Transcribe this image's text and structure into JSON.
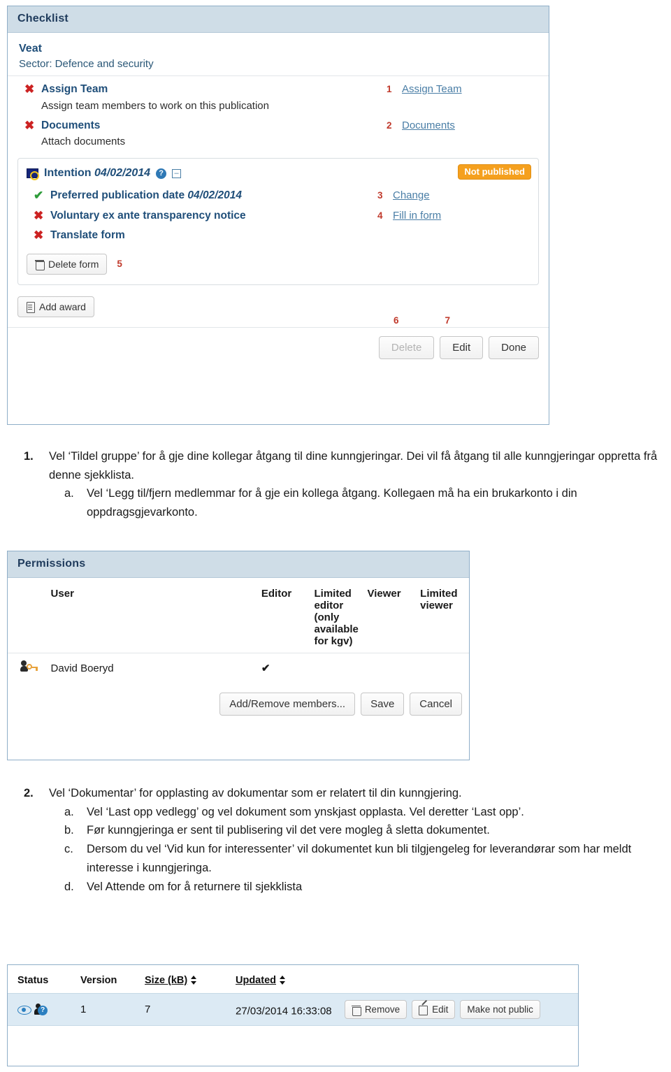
{
  "checklist": {
    "header_title": "Checklist",
    "notice_title": "Veat",
    "sector": "Sector: Defence and security",
    "rows": [
      {
        "status_icon": "cross-icon",
        "label": "Assign Team",
        "description": "Assign team members to work on this publication",
        "step": "1",
        "link": "Assign Team"
      },
      {
        "status_icon": "cross-icon",
        "label": "Documents",
        "description": "Attach documents",
        "step": "2",
        "link": "Documents"
      }
    ],
    "intention": {
      "flag_icon": "eu-flag-icon",
      "title": "Intention",
      "date": "04/02/2014",
      "help_icon": "question-icon",
      "collapse_icon": "collapse-minus-icon",
      "badge": "Not published",
      "rows": [
        {
          "status_icon": "check-icon",
          "label": "Preferred publication date",
          "date": "04/02/2014",
          "step": "3",
          "link": "Change"
        },
        {
          "status_icon": "cross-icon",
          "label": "Voluntary ex ante transparency notice",
          "date": "",
          "step": "4",
          "link": "Fill in form"
        },
        {
          "status_icon": "cross-icon",
          "label": "Translate form",
          "date": "",
          "step": "",
          "link": ""
        }
      ],
      "delete_form_button": "Delete form",
      "delete_form_step": "5"
    },
    "add_award_button": "Add award",
    "tail_step_6": "6",
    "tail_step_7": "7",
    "footer_buttons": {
      "delete": "Delete",
      "edit": "Edit",
      "done": "Done"
    }
  },
  "instructions_1": {
    "marker": "1.",
    "text": "Vel  ‘Tildel gruppe’ for å gje dine kollegar åtgang til dine kunngjeringar. Dei vil få åtgang til alle kunngjeringar oppretta frå denne sjekklista.",
    "sub": [
      {
        "marker": "a.",
        "text": "Vel ‘Legg til/fjern medlemmar for å gje ein kollega åtgang. Kollegaen må ha ein brukarkonto i din oppdragsgjevarkonto."
      }
    ]
  },
  "instructions_2": {
    "marker": "2.",
    "text": "Vel ‘Dokumentar’ for opplasting av dokumentar som er relatert til din kunngjering.",
    "sub": [
      {
        "marker": "a.",
        "text": "Vel ‘Last opp vedlegg’ og vel dokument som ynskjast opplasta. Vel deretter ‘Last opp’."
      },
      {
        "marker": "b.",
        "text": "Før kunngjeringa er sent til publisering vil det vere mogleg å sletta dokumentet."
      },
      {
        "marker": "c.",
        "text": "Dersom du vel ‘Vid kun for interessenter’ vil dokumentet kun bli tilgjengeleg for leverandørar som har meldt interesse i kunngjeringa."
      },
      {
        "marker": "d.",
        "text": "Vel Attende om for å returnere til sjekklista"
      }
    ]
  },
  "permissions": {
    "header_title": "Permissions",
    "columns": {
      "user": "User",
      "editor": "Editor",
      "limited_editor": "Limited editor (only available for kgv)",
      "viewer": "Viewer",
      "limited_viewer": "Limited viewer"
    },
    "rows": [
      {
        "icon": "user-key-icon",
        "name": "David Boeryd",
        "editor": "✔",
        "limited_editor": "",
        "viewer": "",
        "limited_viewer": ""
      }
    ],
    "buttons": {
      "add_remove": "Add/Remove members...",
      "save": "Save",
      "cancel": "Cancel"
    }
  },
  "documents_table": {
    "columns": {
      "status": "Status",
      "version": "Version",
      "size": "Size (kB)",
      "updated": "Updated"
    },
    "rows": [
      {
        "status_icons": [
          "eye-icon",
          "person-question-icon"
        ],
        "version": "1",
        "size": "7",
        "updated": "27/03/2014 16:33:08",
        "buttons": {
          "remove": "Remove",
          "edit": "Edit",
          "make_not_public": "Make not public"
        }
      }
    ]
  },
  "colors": {
    "panel_border": "#8faec8",
    "panel_header_bg": "#cfdde7",
    "heading_navy": "#1f4e79",
    "link_blue": "#4a7ea6",
    "step_red": "#c0392b",
    "cross_red": "#cc2222",
    "check_green": "#2e9c3a",
    "badge_orange": "#f5a01e",
    "row_highlight": "#dceaf4"
  }
}
